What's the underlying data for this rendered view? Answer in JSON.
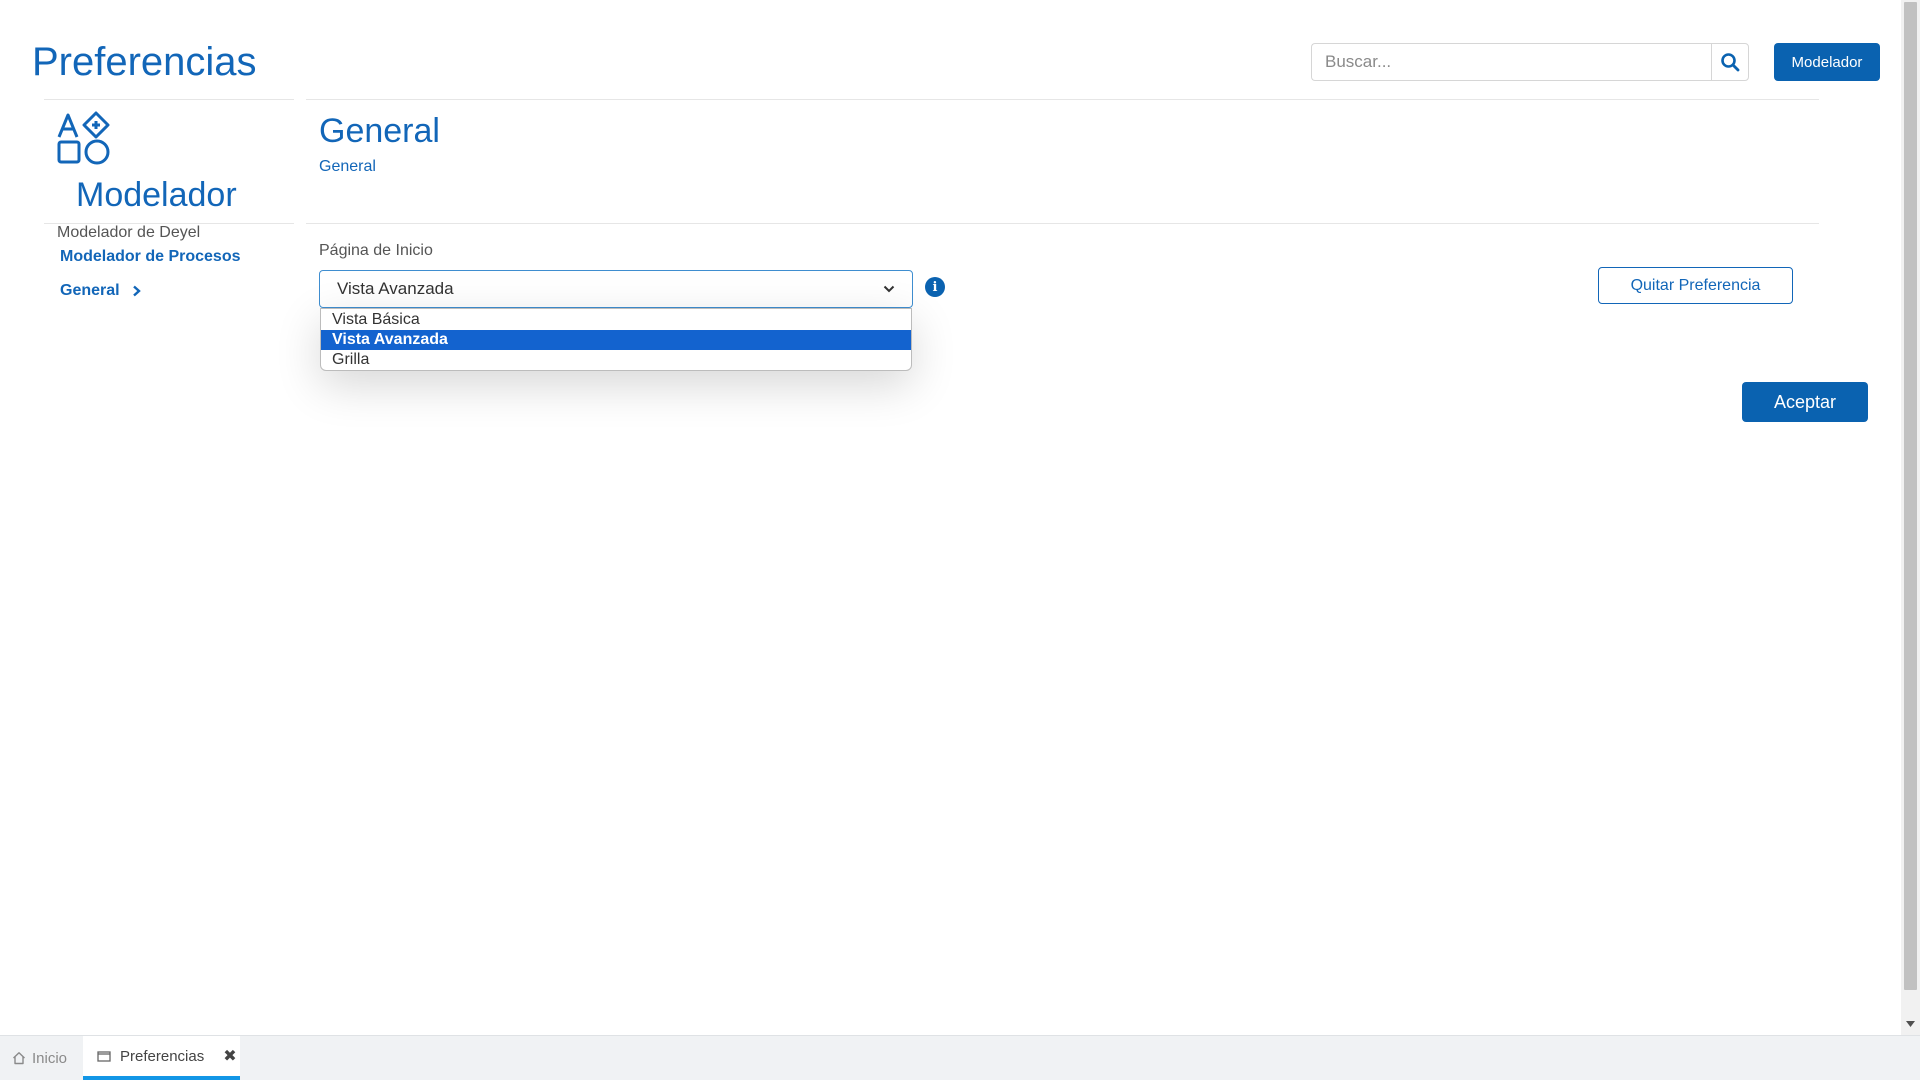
{
  "page": {
    "title": "Preferencias"
  },
  "header": {
    "search_placeholder": "Buscar...",
    "search_icon": "search-icon",
    "modelador_button": "Modelador"
  },
  "sidebar": {
    "app_icon": "shapes-icon",
    "title": "Modelador",
    "subtitle": "Modelador de Deyel",
    "link": "Modelador de Procesos",
    "general_label": "General",
    "general_icon": "chevron-right-icon"
  },
  "main": {
    "section_title": "General",
    "breadcrumb": "General",
    "field_label": "Página de Inicio",
    "select_value": "Vista Avanzada",
    "info_icon": "info-icon",
    "options": [
      "Vista Básica",
      "Vista Avanzada",
      "Grilla"
    ],
    "selected_option": "Vista Avanzada",
    "remove_button": "Quitar Preferencia",
    "accept_button": "Aceptar"
  },
  "tabs": [
    {
      "label": "Inicio",
      "icon": "home-icon",
      "active": false
    },
    {
      "label": "Preferencias",
      "icon": "window-icon",
      "active": true,
      "close_icon": "close-icon"
    }
  ],
  "colors": {
    "brand": "#1266b8",
    "primary_button": "#0a62b0",
    "option_highlight": "#1363cf",
    "tab_indicator": "#1296e6"
  }
}
